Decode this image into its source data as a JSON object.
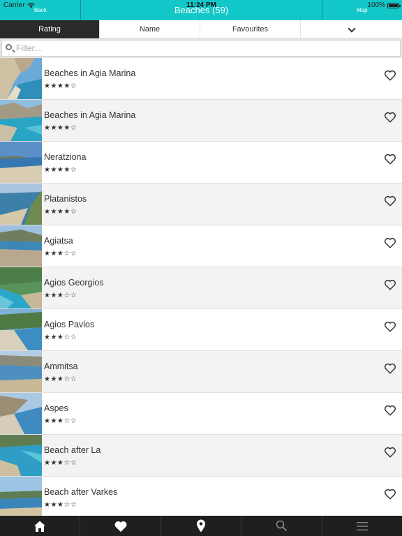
{
  "status": {
    "carrier": "Carrier",
    "time": "11:24 PM",
    "battery": "100%"
  },
  "nav": {
    "back_label": "Back",
    "title": "Beaches (59)",
    "map_label": "Map"
  },
  "sort_tabs": [
    {
      "label": "Rating",
      "active": true
    },
    {
      "label": "Name",
      "active": false
    },
    {
      "label": "Favourites",
      "active": false
    }
  ],
  "filter": {
    "placeholder": "Filter..."
  },
  "beaches": [
    {
      "name": "Beaches in Agia Marina",
      "stars": "★★★★☆",
      "rating": 4
    },
    {
      "name": "Beaches in Agia Marina",
      "stars": "★★★★☆",
      "rating": 4
    },
    {
      "name": "Neratziona",
      "stars": "★★★★☆",
      "rating": 4
    },
    {
      "name": "Platanistos",
      "stars": "★★★★☆",
      "rating": 4
    },
    {
      "name": "Agiatsa",
      "stars": "★★★☆☆",
      "rating": 3
    },
    {
      "name": "Agios Georgios",
      "stars": "★★★☆☆",
      "rating": 3
    },
    {
      "name": "Agios Pavlos",
      "stars": "★★★☆☆",
      "rating": 3
    },
    {
      "name": "Ammitsa",
      "stars": "★★★☆☆",
      "rating": 3
    },
    {
      "name": "Aspes",
      "stars": "★★★☆☆",
      "rating": 3
    },
    {
      "name": "Beach after La",
      "stars": "★★★☆☆",
      "rating": 3
    },
    {
      "name": "Beach after Varkes",
      "stars": "★★★☆☆",
      "rating": 3
    }
  ],
  "tabbar": [
    "home-icon",
    "heart-icon",
    "map-pin-icon",
    "search-icon",
    "menu-icon"
  ],
  "colors": {
    "accent": "#12c7c7",
    "tabbar": "#1f1f1f",
    "active_tab": "#2a2a2a"
  }
}
